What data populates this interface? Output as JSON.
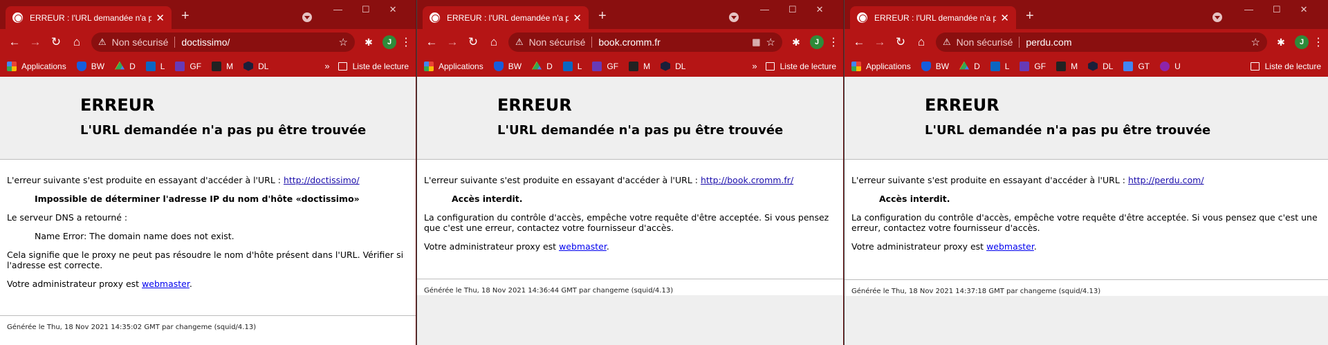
{
  "windows": [
    {
      "tab_title": "ERREUR : l'URL demandée n'a pas pu",
      "omnibox": {
        "security": "Non sécurisé",
        "url": "doctissimo/"
      },
      "bookmarks": [
        {
          "icon": "apps-icon",
          "label": "Applications"
        },
        {
          "icon": "bitwarden-icon",
          "label": "BW"
        },
        {
          "icon": "drive-icon",
          "label": "D"
        },
        {
          "icon": "linkedin-icon",
          "label": "L"
        },
        {
          "icon": "forms-icon",
          "label": "GF"
        },
        {
          "icon": "m-icon",
          "label": "M"
        },
        {
          "icon": "dl-icon",
          "label": "DL"
        }
      ],
      "reading_list": "Liste de lecture",
      "page": {
        "title": "ERREUR",
        "subtitle": "L'URL demandée n'a pas pu être trouvée",
        "intro": "L'erreur suivante s'est produite en essayant d'accéder à l'URL :",
        "link": "http://doctissimo/",
        "error_title": "Impossible de déterminer l'adresse IP du nom d'hôte «doctissimo»",
        "dns_label": "Le serveur DNS a retourné :",
        "dns_error": "Name Error: The domain name does not exist.",
        "explain": "Cela signifie que le proxy ne peut pas résoudre le nom d'hôte présent dans l'URL. Vérifier si l'adresse est correcte.",
        "admin_text": "Votre administrateur proxy est",
        "admin_link": "webmaster",
        "footer": "Générée le Thu, 18 Nov 2021 14:35:02 GMT par changeme (squid/4.13)"
      }
    },
    {
      "tab_title": "ERREUR : l'URL demandée n'a pas p",
      "omnibox": {
        "security": "Non sécurisé",
        "url": "book.cromm.fr"
      },
      "bookmarks": [
        {
          "icon": "apps-icon",
          "label": "Applications"
        },
        {
          "icon": "bitwarden-icon",
          "label": "BW"
        },
        {
          "icon": "drive-icon",
          "label": "D"
        },
        {
          "icon": "linkedin-icon",
          "label": "L"
        },
        {
          "icon": "forms-icon",
          "label": "GF"
        },
        {
          "icon": "m-icon",
          "label": "M"
        },
        {
          "icon": "dl-icon",
          "label": "DL"
        }
      ],
      "reading_list": "Liste de lecture",
      "page": {
        "title": "ERREUR",
        "subtitle": "L'URL demandée n'a pas pu être trouvée",
        "intro": "L'erreur suivante s'est produite en essayant d'accéder à l'URL :",
        "link": "http://book.cromm.fr/",
        "error_title": "Accès interdit.",
        "explain": "La configuration du contrôle d'accès, empêche votre requête d'être acceptée. Si vous pensez que c'est une erreur, contactez votre fournisseur d'accès.",
        "admin_text": "Votre administrateur proxy est",
        "admin_link": "webmaster",
        "footer": "Générée le Thu, 18 Nov 2021 14:36:44 GMT par changeme (squid/4.13)"
      }
    },
    {
      "tab_title": "ERREUR : l'URL demandée n'a pas p",
      "omnibox": {
        "security": "Non sécurisé",
        "url": "perdu.com"
      },
      "bookmarks": [
        {
          "icon": "apps-icon",
          "label": "Applications"
        },
        {
          "icon": "bitwarden-icon",
          "label": "BW"
        },
        {
          "icon": "drive-icon",
          "label": "D"
        },
        {
          "icon": "linkedin-icon",
          "label": "L"
        },
        {
          "icon": "forms-icon",
          "label": "GF"
        },
        {
          "icon": "m-icon",
          "label": "M"
        },
        {
          "icon": "dl-icon",
          "label": "DL"
        },
        {
          "icon": "translate-icon",
          "label": "GT"
        },
        {
          "icon": "u-icon",
          "label": "U"
        }
      ],
      "reading_list": "Liste de lecture",
      "page": {
        "title": "ERREUR",
        "subtitle": "L'URL demandée n'a pas pu être trouvée",
        "intro": "L'erreur suivante s'est produite en essayant d'accéder à l'URL :",
        "link": "http://perdu.com/",
        "error_title": "Accès interdit.",
        "explain": "La configuration du contrôle d'accès, empêche votre requête d'être acceptée. Si vous pensez que c'est une erreur, contactez votre fournisseur d'accès.",
        "admin_text": "Votre administrateur proxy est",
        "admin_link": "webmaster",
        "footer": "Générée le Thu, 18 Nov 2021 14:37:18 GMT par changeme (squid/4.13)"
      }
    }
  ],
  "profile_initial": "J",
  "colors": {
    "frame": "#8a0f0f",
    "toolbar": "#b51515",
    "page_header": "#efefef",
    "link": "#1a0dab"
  }
}
